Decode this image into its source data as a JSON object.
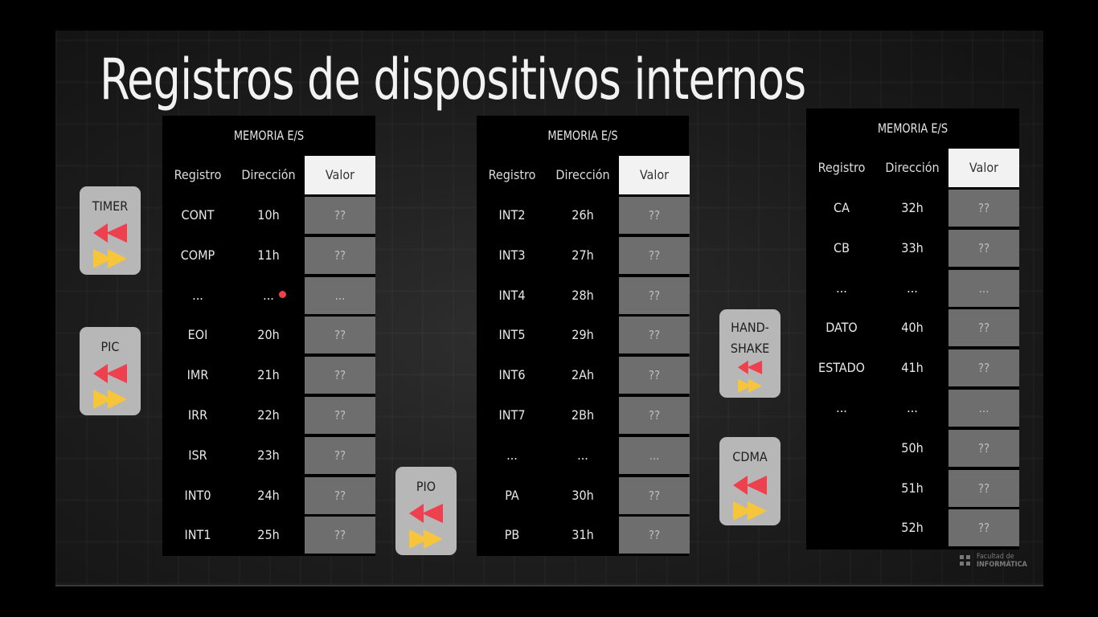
{
  "title": "Registros de dispositivos internos",
  "colors": {
    "valor_header_bg": "#f2f2f2",
    "value_cell_bg": "#6e6e6e",
    "device_bg": "#b7b7b7",
    "arrow_red": "#ee4150",
    "arrow_yellow": "#f6c53b",
    "dot_red": "#f0404a"
  },
  "tables": [
    {
      "header": "MEMORIA E/S",
      "columns": [
        "Registro",
        "Dirección",
        "Valor"
      ],
      "rows": [
        {
          "reg": "CONT",
          "dir": "10h",
          "val": "??"
        },
        {
          "reg": "COMP",
          "dir": "11h",
          "val": "??"
        },
        {
          "reg": "...",
          "dir": "...",
          "val": "..."
        },
        {
          "reg": "EOI",
          "dir": "20h",
          "val": "??"
        },
        {
          "reg": "IMR",
          "dir": "21h",
          "val": "??"
        },
        {
          "reg": "IRR",
          "dir": "22h",
          "val": "??"
        },
        {
          "reg": "ISR",
          "dir": "23h",
          "val": "??"
        },
        {
          "reg": "INT0",
          "dir": "24h",
          "val": "??"
        },
        {
          "reg": "INT1",
          "dir": "25h",
          "val": "??"
        }
      ]
    },
    {
      "header": "MEMORIA E/S",
      "columns": [
        "Registro",
        "Dirección",
        "Valor"
      ],
      "rows": [
        {
          "reg": "INT2",
          "dir": "26h",
          "val": "??"
        },
        {
          "reg": "INT3",
          "dir": "27h",
          "val": "??"
        },
        {
          "reg": "INT4",
          "dir": "28h",
          "val": "??"
        },
        {
          "reg": "INT5",
          "dir": "29h",
          "val": "??"
        },
        {
          "reg": "INT6",
          "dir": "2Ah",
          "val": "??"
        },
        {
          "reg": "INT7",
          "dir": "2Bh",
          "val": "??"
        },
        {
          "reg": "...",
          "dir": "...",
          "val": "..."
        },
        {
          "reg": "PA",
          "dir": "30h",
          "val": "??"
        },
        {
          "reg": "PB",
          "dir": "31h",
          "val": "??"
        }
      ]
    },
    {
      "header": "MEMORIA E/S",
      "columns": [
        "Registro",
        "Dirección",
        "Valor"
      ],
      "rows": [
        {
          "reg": "CA",
          "dir": "32h",
          "val": "??"
        },
        {
          "reg": "CB",
          "dir": "33h",
          "val": "??"
        },
        {
          "reg": "...",
          "dir": "...",
          "val": "..."
        },
        {
          "reg": "DATO",
          "dir": "40h",
          "val": "??"
        },
        {
          "reg": "ESTADO",
          "dir": "41h",
          "val": "??"
        },
        {
          "reg": "...",
          "dir": "...",
          "val": "..."
        },
        {
          "reg": "",
          "dir": "50h",
          "val": "??"
        },
        {
          "reg": "",
          "dir": "51h",
          "val": "??"
        },
        {
          "reg": "",
          "dir": "52h",
          "val": "??"
        }
      ]
    }
  ],
  "devices": [
    {
      "label": "TIMER",
      "icon": "bidirectional-arrows-icon"
    },
    {
      "label": "PIC",
      "icon": "bidirectional-arrows-icon"
    },
    {
      "label": "PIO",
      "icon": "bidirectional-arrows-icon"
    },
    {
      "label": "HAND-\nSHAKE",
      "icon": "bidirectional-arrows-icon"
    },
    {
      "label": "CDMA",
      "icon": "bidirectional-arrows-icon"
    }
  ],
  "logo": {
    "line1": "Facultad de",
    "line2": "INFORMÁTICA"
  }
}
